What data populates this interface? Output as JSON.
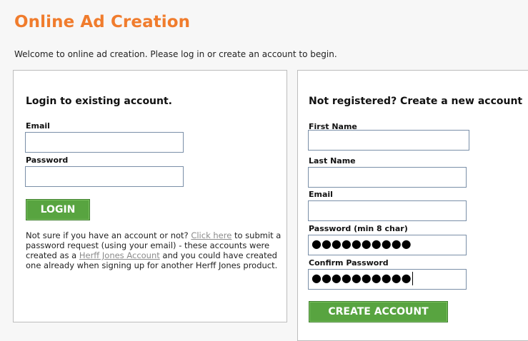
{
  "page": {
    "title": "Online Ad Creation",
    "welcome": "Welcome to online ad creation. Please log in or create an account to begin."
  },
  "login": {
    "heading": "Login to existing account.",
    "email_label": "Email",
    "email_value": "",
    "password_label": "Password",
    "password_value": "",
    "button_label": "LOGIN",
    "help_before_link": "Not sure if you have an account or not?",
    "help_link_click_here": "Click here",
    "help_middle": "to submit a password request (using your email) - these accounts were created as a",
    "help_link_account": "Herff Jones Account",
    "help_after": "and you could have created one already when signing up for another Herff Jones product."
  },
  "register": {
    "heading": "Not registered? Create a new account",
    "first_name_label": "First Name",
    "first_name_value": "",
    "last_name_label": "Last Name",
    "last_name_value": "",
    "email_label": "Email",
    "email_value": "",
    "password_label": "Password (min 8 char)",
    "password_masked": "●●●●●●●●●●",
    "confirm_password_label": "Confirm Password",
    "confirm_password_masked": "●●●●●●●●●●",
    "button_label": "CREATE ACCOUNT"
  },
  "colors": {
    "title": "#f07c2d",
    "button_green": "#58a440",
    "link_gray": "#8b8b8b",
    "panel_border": "#bdbdbd",
    "input_border": "#7a8fa8"
  }
}
